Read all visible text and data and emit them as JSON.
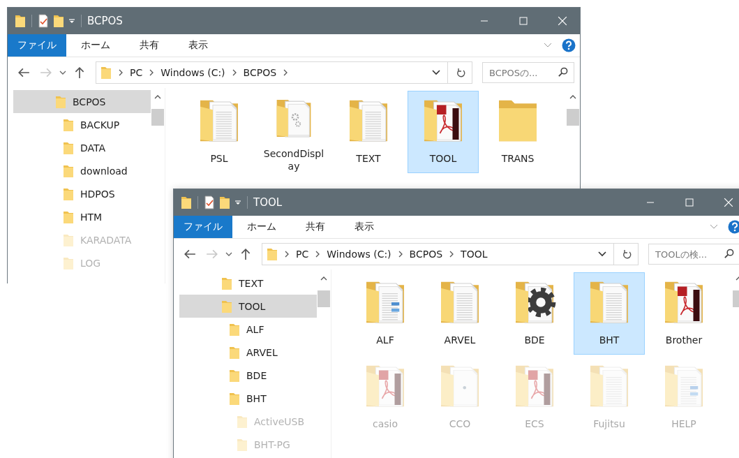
{
  "windows": [
    {
      "title": "BCPOS",
      "ribbon_tabs": [
        {
          "label": "ファイル",
          "kind": "file-menu"
        },
        {
          "label": "ホーム",
          "kind": "tab"
        },
        {
          "label": "共有",
          "kind": "tab"
        },
        {
          "label": "表示",
          "kind": "tab"
        }
      ],
      "address": [
        "PC",
        "Windows (C:)",
        "BCPOS"
      ],
      "trailing_chevron": true,
      "search": {
        "placeholder": "BCPOSの..."
      },
      "sidebar": [
        {
          "label": "BCPOS",
          "selected": true,
          "faded": false,
          "children": [
            {
              "label": "BACKUP",
              "selected": false,
              "faded": false
            },
            {
              "label": "DATA",
              "selected": false,
              "faded": false
            },
            {
              "label": "download",
              "selected": false,
              "faded": false
            },
            {
              "label": "HDPOS",
              "selected": false,
              "faded": false
            },
            {
              "label": "HTM",
              "selected": false,
              "faded": false
            },
            {
              "label": "KARADATA",
              "selected": false,
              "faded": true
            },
            {
              "label": "LOG",
              "selected": false,
              "faded": true
            }
          ]
        }
      ],
      "files": [
        {
          "name": "PSL",
          "kind": "docs",
          "selected": false,
          "faded": false
        },
        {
          "name": "SecondDisplay",
          "kind": "gear-doc",
          "selected": false,
          "faded": false
        },
        {
          "name": "TEXT",
          "kind": "docs",
          "selected": false,
          "faded": false
        },
        {
          "name": "TOOL",
          "kind": "pdf",
          "selected": true,
          "faded": false
        },
        {
          "name": "TRANS",
          "kind": "empty",
          "selected": false,
          "faded": false
        }
      ]
    },
    {
      "title": "TOOL",
      "ribbon_tabs": [
        {
          "label": "ファイル",
          "kind": "file-menu"
        },
        {
          "label": "ホーム",
          "kind": "tab"
        },
        {
          "label": "共有",
          "kind": "tab"
        },
        {
          "label": "表示",
          "kind": "tab"
        }
      ],
      "address": [
        "PC",
        "Windows (C:)",
        "BCPOS",
        "TOOL"
      ],
      "trailing_chevron": false,
      "search": {
        "placeholder": "TOOLの検..."
      },
      "sidebar": [
        {
          "label": "TEXT",
          "selected": false,
          "faded": false
        },
        {
          "label": "TOOL",
          "selected": true,
          "faded": false,
          "children": [
            {
              "label": "ALF",
              "selected": false,
              "faded": false
            },
            {
              "label": "ARVEL",
              "selected": false,
              "faded": false
            },
            {
              "label": "BDE",
              "selected": false,
              "faded": false
            },
            {
              "label": "BHT",
              "selected": false,
              "faded": false,
              "children": [
                {
                  "label": "ActiveUSB",
                  "selected": false,
                  "faded": true
                },
                {
                  "label": "BHT-PG",
                  "selected": false,
                  "faded": true
                }
              ]
            }
          ]
        }
      ],
      "files": [
        {
          "name": "ALF",
          "kind": "blue-doc",
          "selected": false,
          "faded": false
        },
        {
          "name": "ARVEL",
          "kind": "docs",
          "selected": false,
          "faded": false
        },
        {
          "name": "BDE",
          "kind": "gear",
          "selected": false,
          "faded": false
        },
        {
          "name": "BHT",
          "kind": "docs",
          "selected": true,
          "faded": false
        },
        {
          "name": "Brother",
          "kind": "pdf",
          "selected": false,
          "faded": false
        },
        {
          "name": "casio",
          "kind": "pdf",
          "selected": false,
          "faded": true
        },
        {
          "name": "CCO",
          "kind": "dot-doc",
          "selected": false,
          "faded": true
        },
        {
          "name": "ECS",
          "kind": "pdf",
          "selected": false,
          "faded": true
        },
        {
          "name": "Fujitsu",
          "kind": "docs",
          "selected": false,
          "faded": true
        },
        {
          "name": "HELP",
          "kind": "blue-doc",
          "selected": false,
          "faded": true
        }
      ]
    }
  ]
}
